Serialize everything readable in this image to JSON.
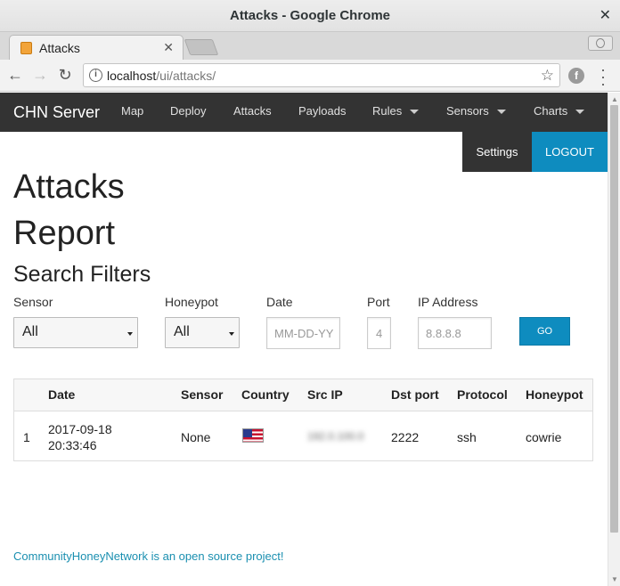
{
  "window": {
    "title": "Attacks - Google Chrome"
  },
  "tab": {
    "label": "Attacks"
  },
  "address": {
    "host": "localhost",
    "path": "/ui/attacks/"
  },
  "navbar": {
    "brand": "CHN Server",
    "items": [
      {
        "label": "Map"
      },
      {
        "label": "Deploy"
      },
      {
        "label": "Attacks"
      },
      {
        "label": "Payloads"
      },
      {
        "label": "Rules"
      },
      {
        "label": "Sensors"
      },
      {
        "label": "Charts"
      }
    ],
    "settings": "Settings",
    "logout": "LOGOUT"
  },
  "page": {
    "title": "Attacks Report",
    "filters_title": "Search Filters"
  },
  "filters": {
    "sensor_label": "Sensor",
    "sensor_value": "All",
    "honeypot_label": "Honeypot",
    "honeypot_value": "All",
    "date_label": "Date",
    "date_placeholder": "MM-DD-YY",
    "port_label": "Port",
    "port_placeholder": "4",
    "ip_label": "IP Address",
    "ip_placeholder": "8.8.8.8",
    "go": "GO"
  },
  "table": {
    "headers": [
      "Date",
      "Sensor",
      "Country",
      "Src IP",
      "Dst port",
      "Protocol",
      "Honeypot"
    ],
    "rows": [
      {
        "index": "1",
        "date_line1": "2017-09-18",
        "date_line2": "20:33:46",
        "sensor": "None",
        "country_flag": "us-flag-icon",
        "src_ip": "192.0.100.0",
        "dst_port": "2222",
        "protocol": "ssh",
        "honeypot": "cowrie"
      }
    ]
  },
  "footer": {
    "link": "CommunityHoneyNetwork is an open source project!"
  },
  "colors": {
    "navbar": "#333333",
    "accent": "#0e8cbf",
    "link": "#1a8fb0"
  }
}
